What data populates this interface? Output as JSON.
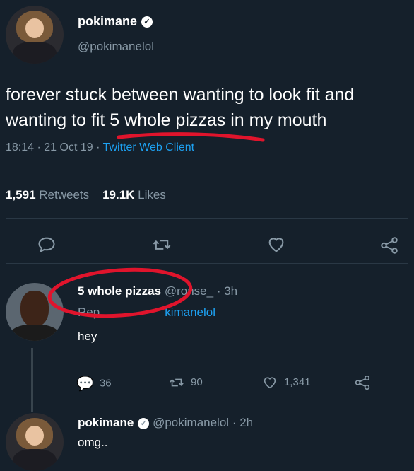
{
  "tweet": {
    "author_name": "pokimane",
    "author_handle": "@pokimanelol",
    "text": "forever stuck between wanting to look fit and wanting to fit 5 whole pizzas in my mouth",
    "time": "18:14",
    "date": "21 Oct 19",
    "sep": "·",
    "client": "Twitter Web Client",
    "retweets_count": "1,591",
    "retweets_label": "Retweets",
    "likes_count": "19.1K",
    "likes_label": "Likes"
  },
  "reply1": {
    "name": "5 whole pizzas",
    "handle": "@",
    "handle_rest": "ronse_",
    "age": "· 3h",
    "replying_label": "Rep",
    "replying_mention": "kimanelol",
    "text": "hey",
    "reply_count": "36",
    "retweet_count": "90",
    "like_count": "1,341"
  },
  "reply2": {
    "name": "pokimane",
    "handle": "@pokimanelol",
    "age": "· 2h",
    "text": "omg.."
  },
  "icons": {
    "reply": "reply-icon",
    "retweet": "retweet-icon",
    "like": "heart-icon",
    "share": "share-icon",
    "verified": "verified-badge-icon"
  },
  "colors": {
    "background": "#15202b",
    "secondary_text": "#8899a6",
    "link": "#1da1f2",
    "annotation": "#e0142c"
  }
}
